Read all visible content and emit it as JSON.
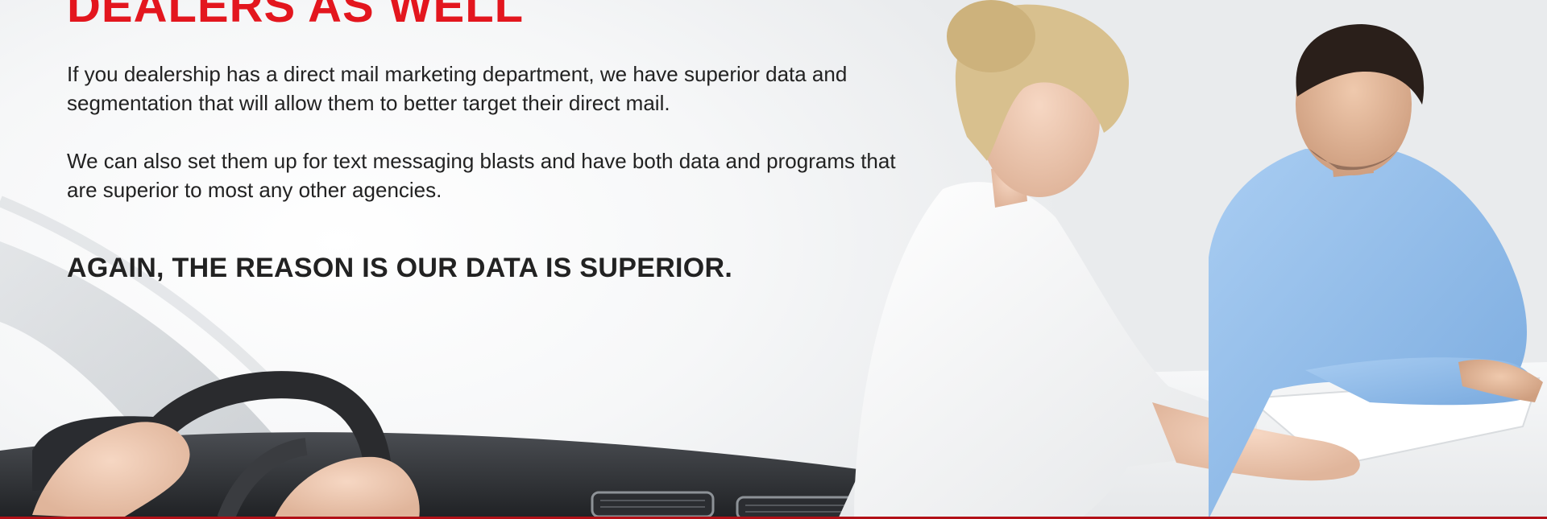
{
  "section": {
    "headline": "DEALERS AS WELL",
    "paragraph_1": "If you dealership has a direct mail marketing department, we have superior data and segmentation that will allow them to better target their direct mail.",
    "paragraph_2": "We can also set them up for text messaging blasts and have both data and programs that are superior to most any other agencies.",
    "tagline": "AGAIN, THE REASON IS OUR DATA IS SUPERIOR."
  },
  "colors": {
    "accent": "#e3161e",
    "text": "#222222",
    "rule": "#b21017"
  }
}
